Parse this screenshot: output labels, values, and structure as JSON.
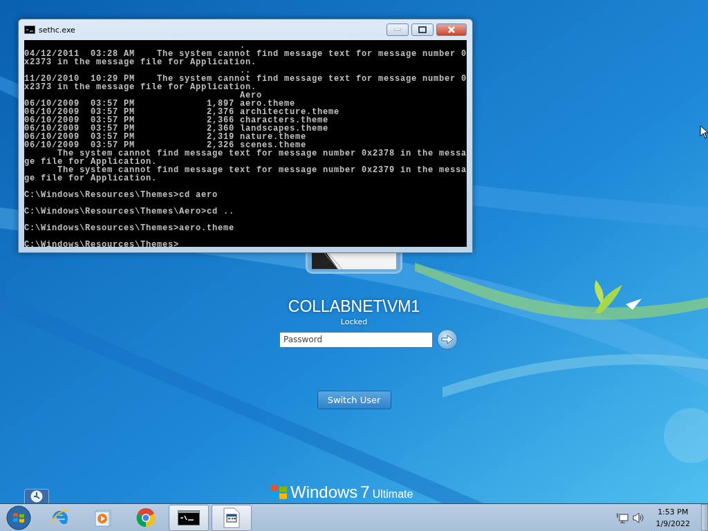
{
  "console": {
    "title": "sethc.exe",
    "blocks": [
      [
        "                                       .",
        "04/12/2011  03:28 AM    The system cannot find message text for message number 0",
        "x2373 in the message file for Application.",
        "                                       ..",
        "11/20/2010  10:29 PM    The system cannot find message text for message number 0",
        "x2373 in the message file for Application.",
        "                                       Aero",
        "06/10/2009  03:57 PM             1,897 aero.theme",
        "06/10/2009  03:57 PM             2,376 architecture.theme",
        "06/10/2009  03:57 PM             2,366 characters.theme",
        "06/10/2009  03:57 PM             2,360 landscapes.theme",
        "06/10/2009  03:57 PM             2,319 nature.theme",
        "06/10/2009  03:57 PM             2,326 scenes.theme",
        "      The system cannot find message text for message number 0x2378 in the messa",
        "ge file for Application.",
        "      The system cannot find message text for message number 0x2379 in the messa",
        "ge file for Application."
      ],
      [
        "C:\\Windows\\Resources\\Themes>cd aero"
      ],
      [
        "C:\\Windows\\Resources\\Themes\\Aero>cd .."
      ],
      [
        "C:\\Windows\\Resources\\Themes>aero.theme"
      ],
      [
        "C:\\Windows\\Resources\\Themes>"
      ]
    ]
  },
  "lock_screen": {
    "user": "COLLABNET\\VM1",
    "status": "Locked",
    "password": {
      "placeholder": "Password"
    },
    "switch_user": "Switch User"
  },
  "branding": {
    "name": "Windows",
    "version": "7",
    "edition": "Ultimate"
  },
  "taskbar": {
    "items": [
      {
        "kind": "browser-e",
        "running": false
      },
      {
        "kind": "media",
        "running": false
      },
      {
        "kind": "chrome",
        "running": false
      },
      {
        "kind": "console",
        "running": true
      },
      {
        "kind": "document",
        "running": true
      }
    ],
    "time": "1:53 PM",
    "date": "1/9/2022"
  }
}
